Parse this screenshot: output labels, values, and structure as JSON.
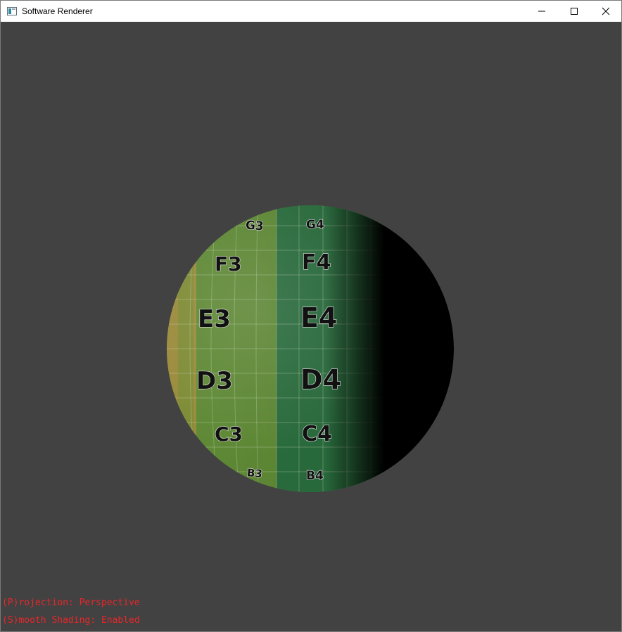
{
  "window": {
    "title": "Software Renderer",
    "controls": [
      "minimize",
      "maximize",
      "close"
    ]
  },
  "viewport": {
    "background": "#424242",
    "sphere_labels": {
      "g3": "G3",
      "g4": "G4",
      "f3": "F3",
      "f4": "F4",
      "e3": "E3",
      "e4": "E4",
      "d3": "D3",
      "d4": "D4",
      "c3": "C3",
      "c4": "C4",
      "b3": "B3",
      "b4": "B4"
    }
  },
  "hud": {
    "projection": "(P)rojection: Perspective",
    "smooth_shading": "(S)mooth Shading: Enabled",
    "color": "#e8262a"
  }
}
